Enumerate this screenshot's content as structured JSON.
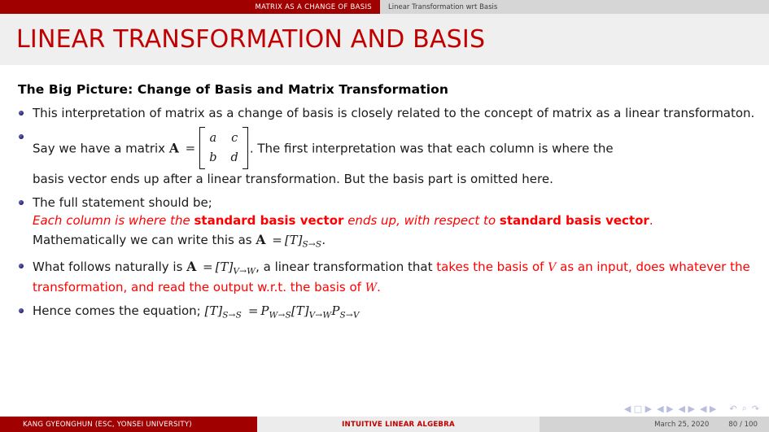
{
  "header": {
    "section": "MATRIX AS A CHANGE OF BASIS",
    "subsection": "Linear Transformation wrt Basis"
  },
  "title": "LINEAR TRANSFORMATION AND BASIS",
  "block": {
    "heading": "The Big Picture: Change of Basis and Matrix Transformation"
  },
  "bullets": {
    "b1": {
      "text": "This interpretation of matrix as a change of basis is closely related to the concept of matrix as a linear transformaton."
    },
    "b2": {
      "lead": "Say we have a matrix",
      "matrix_symbol": "A",
      "equals": "=",
      "matrix": {
        "a": "a",
        "c": "c",
        "b": "b",
        "d": "d"
      },
      "mid": ". The first interpretation was that each column is where the",
      "tail": "basis vector ends up after a linear transformation. But the basis part is omitted here."
    },
    "b3": {
      "lead": "The full statement should be;",
      "red_1": "Each column is where the",
      "red_bold_1": "standard basis vector",
      "red_2": "ends up, with respect to",
      "red_bold_2": "standard basis vector",
      "red_3": ".",
      "math_lead": "Mathematically we can write this as",
      "math_symbol": "A",
      "math_equals": "=",
      "math_T": "[T]",
      "math_sub": "S→S",
      "math_period": "."
    },
    "b4": {
      "lead": "What follows naturally is",
      "symbol": "A",
      "equals": "=",
      "T": "[T]",
      "sub": "V→W",
      "mid": ", a linear transformation that",
      "red_1": "takes the basis of",
      "red_V": "V",
      "red_2": "as an input, does whatever the transformation, and read the output w.r.t. the basis of",
      "red_W": "W",
      "red_3": "."
    },
    "b5": {
      "lead": "Hence comes the equation;",
      "lhs_T": "[T]",
      "lhs_sub": "S→S",
      "equals": "=",
      "p1": "P",
      "p1_sub": "W→S",
      "t2": "[T]",
      "t2_sub": "V→W",
      "p2": "P",
      "p2_sub": "S→V"
    }
  },
  "navigation": {
    "first_slide": "◀ □ ▶",
    "prev_frame": "◀ ▶",
    "prev_subsection": "◀ ▶",
    "prev_section": "◀ ▶",
    "back": "↶",
    "search": "⌕",
    "forward": "↷"
  },
  "footer": {
    "author": "KANG GYEONGHUN  (ESC, YONSEI UNIVERSITY)",
    "talk_title": "INTUITIVE LINEAR ALGEBRA",
    "date": "March 25, 2020",
    "page": "80 / 100"
  },
  "colors": {
    "brand_red": "#a10000",
    "title_red": "#c00000",
    "emphasis_red": "#ff0000",
    "bullet_blue": "#1f1f6e",
    "title_band": "#efefef",
    "nav_symbol": "#b9bede"
  }
}
